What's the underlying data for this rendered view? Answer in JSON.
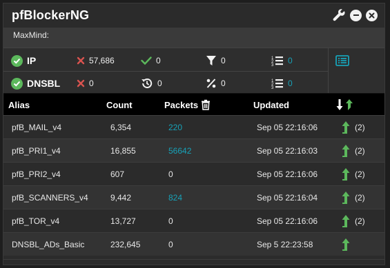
{
  "widget": {
    "title": "pfBlockerNG",
    "subtitle": "MaxMind:",
    "header_icons": [
      "wrench-icon",
      "minimize-icon",
      "close-icon"
    ]
  },
  "stats": {
    "ip": {
      "label": "IP",
      "blocked": "57,686",
      "permitted": "0",
      "match": "0",
      "alias_count": "0"
    },
    "dnsbl": {
      "label": "DNSBL",
      "blocked": "0",
      "history": "0",
      "percent": "0",
      "alias_count": "0"
    }
  },
  "table": {
    "headers": {
      "alias": "Alias",
      "count": "Count",
      "packets": "Packets",
      "updated": "Updated"
    },
    "rows": [
      {
        "alias": "pfB_MAIL_v4",
        "count": "6,354",
        "packets": "220",
        "packets_link": true,
        "updated": "Sep 05 22:16:06",
        "rules": "(2)"
      },
      {
        "alias": "pfB_PRI1_v4",
        "count": "16,855",
        "packets": "56642",
        "packets_link": true,
        "updated": "Sep 05 22:16:03",
        "rules": "(2)"
      },
      {
        "alias": "pfB_PRI2_v4",
        "count": "607",
        "packets": "0",
        "packets_link": false,
        "updated": "Sep 05 22:16:06",
        "rules": "(2)"
      },
      {
        "alias": "pfB_SCANNERS_v4",
        "count": "9,442",
        "packets": "824",
        "packets_link": true,
        "updated": "Sep 05 22:16:04",
        "rules": "(2)"
      },
      {
        "alias": "pfB_TOR_v4",
        "count": "13,727",
        "packets": "0",
        "packets_link": false,
        "updated": "Sep 05 22:16:06",
        "rules": "(2)"
      },
      {
        "alias": "DNSBL_ADs_Basic",
        "count": "232,645",
        "packets": "0",
        "packets_link": false,
        "updated": "Sep 5 22:23:58",
        "rules": ""
      }
    ]
  },
  "colors": {
    "green": "#5cb85c",
    "red": "#d9534f",
    "teal": "#17a2b8"
  }
}
